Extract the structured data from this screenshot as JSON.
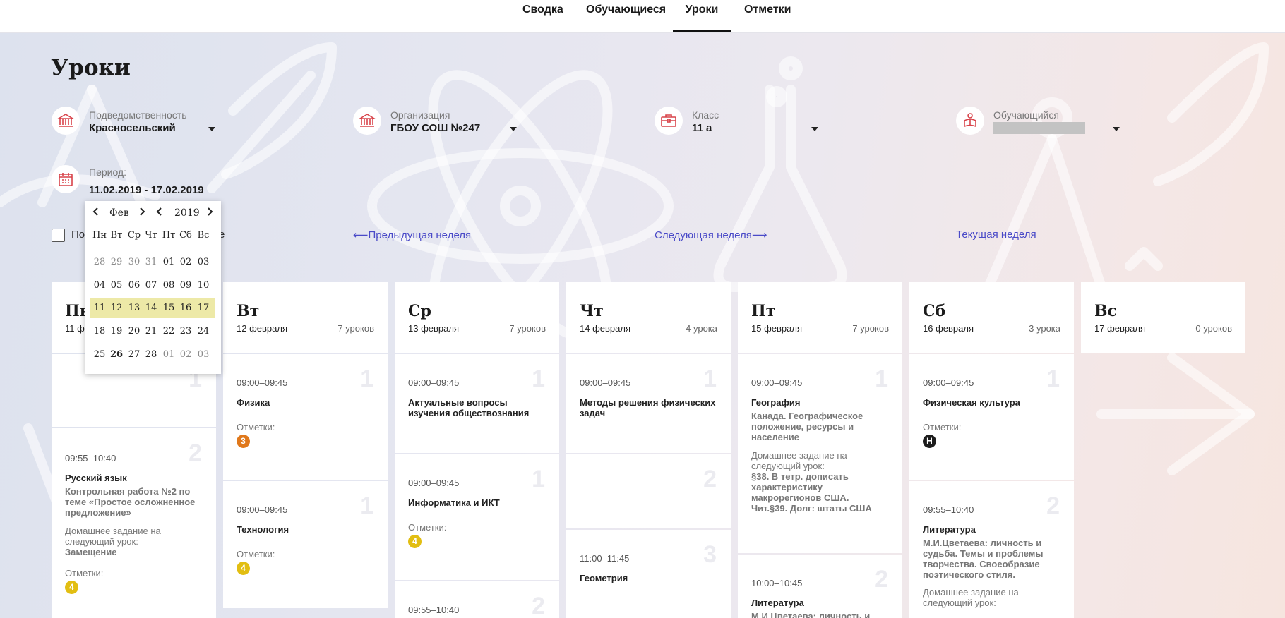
{
  "nav": {
    "tabs": [
      {
        "label": "Сводка",
        "active": false
      },
      {
        "label": "Обучающиеся",
        "active": false
      },
      {
        "label": "Уроки",
        "active": true
      },
      {
        "label": "Отметки",
        "active": false
      }
    ]
  },
  "page": {
    "title": "Уроки"
  },
  "filters": {
    "department": {
      "label": "Подведомственность",
      "value": "Красносельский",
      "icon": "building-icon"
    },
    "organization": {
      "label": "Организация",
      "value": "ГБОУ СОШ №247",
      "icon": "building-icon"
    },
    "class": {
      "label": "Класс",
      "value": "11 а",
      "icon": "briefcase-icon"
    },
    "student": {
      "label": "Обучающийся",
      "value": "",
      "icon": "student-icon"
    },
    "period": {
      "label": "Период:",
      "value": "11.02.2019 - 17.02.2019",
      "icon": "calendar-icon"
    }
  },
  "checkbox": {
    "label_left": "По",
    "label_right": "е"
  },
  "week_nav": {
    "prev": "⟵Предыдущая неделя",
    "next": "Следующая неделя⟶",
    "current": "Текущая неделя"
  },
  "datepicker": {
    "month": "Фев",
    "year": "2019",
    "weekdays": [
      "Пн",
      "Вт",
      "Ср",
      "Чт",
      "Пт",
      "Сб",
      "Вс"
    ],
    "weeks": [
      [
        "28",
        "29",
        "30",
        "31",
        "01",
        "02",
        "03"
      ],
      [
        "04",
        "05",
        "06",
        "07",
        "08",
        "09",
        "10"
      ],
      [
        "11",
        "12",
        "13",
        "14",
        "15",
        "16",
        "17"
      ],
      [
        "18",
        "19",
        "20",
        "21",
        "22",
        "23",
        "24"
      ],
      [
        "25",
        "26",
        "27",
        "28",
        "01",
        "02",
        "03"
      ]
    ],
    "selected_week_index": 2,
    "today": "26"
  },
  "days": [
    {
      "name": "Пн",
      "date": "11 ф",
      "count": ""
    },
    {
      "name": "Вт",
      "date": "12 февраля",
      "count": "7 уроков"
    },
    {
      "name": "Ср",
      "date": "13 февраля",
      "count": "7 уроков"
    },
    {
      "name": "Чт",
      "date": "14 февраля",
      "count": "4 урока"
    },
    {
      "name": "Пт",
      "date": "15 февраля",
      "count": "7 уроков"
    },
    {
      "name": "Сб",
      "date": "16 февраля",
      "count": "3 урока"
    },
    {
      "name": "Вс",
      "date": "17 февраля",
      "count": "0 уроков"
    }
  ],
  "lessons": {
    "mon": [
      {
        "num": "1"
      },
      {
        "num": "2",
        "time": "09:55–10:40",
        "subject": "Русский язык",
        "topic": "Контрольная работа №2 по теме «Простое осложненное предложение»",
        "hw_label": "Домашнее задание на следующий урок:",
        "hw": "Замещение",
        "grades_label": "Отметки:",
        "grade": "4"
      }
    ],
    "tue": [
      {
        "num": "1",
        "time": "09:00–09:45",
        "subject": "Физика",
        "grades_label": "Отметки:",
        "grade": "3"
      },
      {
        "num": "1",
        "time": "09:00–09:45",
        "subject": "Технология",
        "grades_label": "Отметки:",
        "grade": "4"
      }
    ],
    "wed": [
      {
        "num": "1",
        "time": "09:00–09:45",
        "subject": "Актуальные вопросы изучения обществознания"
      },
      {
        "num": "1",
        "time": "09:00–09:45",
        "subject": "Информатика и ИКТ",
        "grades_label": "Отметки:",
        "grade": "4"
      },
      {
        "num": "2",
        "time": "09:55–10:40"
      }
    ],
    "thu": [
      {
        "num": "1",
        "time": "09:00–09:45",
        "subject": "Методы решения физических задач"
      },
      {
        "num": "2"
      },
      {
        "num": "3",
        "time": "11:00–11:45",
        "subject": "Геометрия"
      }
    ],
    "fri": [
      {
        "num": "1",
        "time": "09:00–09:45",
        "subject": "География",
        "topic": "Канада. Географическое положение, ресурсы и население",
        "hw_label": "Домашнее задание на следующий урок:",
        "hw": "§38. В тетр. дописать характеристику макрорегионов США. Чит.§39. Долг: штаты США"
      },
      {
        "num": "2",
        "time": "10:00–10:45",
        "subject": "Литература",
        "topic": "М.И.Цветаева: личность и"
      }
    ],
    "sat": [
      {
        "num": "1",
        "time": "09:00–09:45",
        "subject": "Физическая культура",
        "grades_label": "Отметки:",
        "grade": "Н"
      },
      {
        "num": "2",
        "time": "09:55–10:40",
        "subject": "Литература",
        "topic": "М.И.Цветаева: личность и судьба. Темы и проблемы творчества. Своеобразие поэтического стиля.",
        "hw_label": "Домашнее задание на следующий урок:"
      }
    ]
  },
  "colors": {
    "grade_3": "#e0781b",
    "grade_4": "#e2be12",
    "grade_absent": "#1c1c1c",
    "icon_red": "#d8434a",
    "link": "#4a4ac8",
    "week_highlight": "#ede9a7"
  }
}
